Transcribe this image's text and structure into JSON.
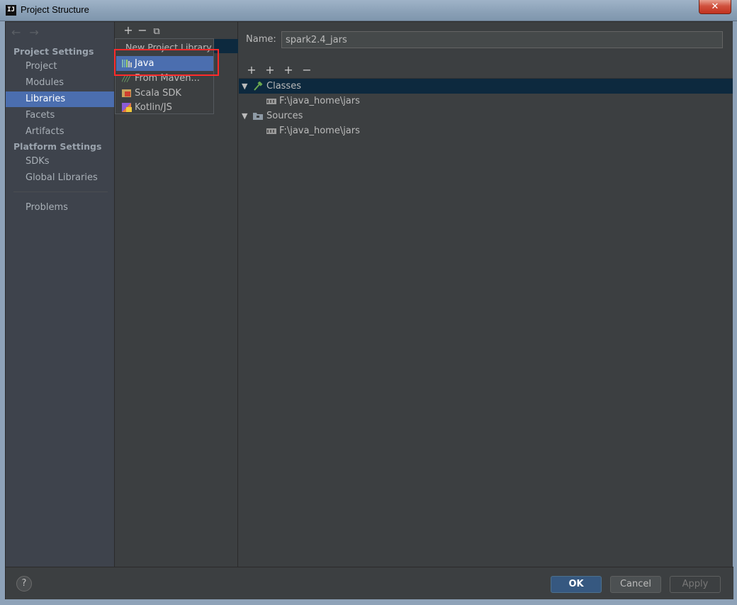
{
  "window": {
    "title": "Project Structure",
    "app_icon_text": "IJ",
    "close_glyph": "✕"
  },
  "nav": {
    "back_arrow": "←",
    "forward_arrow": "→",
    "project_settings_header": "Project Settings",
    "project_items": [
      "Project",
      "Modules",
      "Libraries",
      "Facets",
      "Artifacts"
    ],
    "platform_settings_header": "Platform Settings",
    "platform_items": [
      "SDKs",
      "Global Libraries"
    ],
    "problems": "Problems",
    "selected": "Libraries"
  },
  "mid_toolbar": {
    "add": "+",
    "remove": "−",
    "copy": "⧉"
  },
  "popup": {
    "header": "New Project Library",
    "items": [
      {
        "label": "Java",
        "icon": "java-library-icon",
        "highlighted": true
      },
      {
        "label": "From Maven...",
        "icon": "maven-icon",
        "highlighted": false
      },
      {
        "label": "Scala SDK",
        "icon": "scala-sdk-icon",
        "highlighted": false
      },
      {
        "label": "Kotlin/JS",
        "icon": "kotlin-js-icon",
        "highlighted": false
      }
    ]
  },
  "details": {
    "name_label": "Name:",
    "name_value": "spark2.4_jars",
    "toolbar": {
      "add": "+",
      "add_alt": "+",
      "add_jar": "+",
      "remove": "−"
    },
    "tree": [
      {
        "label": "Classes",
        "type": "group",
        "icon": "classes-hammer-icon"
      },
      {
        "label": "F:\\java_home\\jars",
        "type": "path",
        "icon": "jar-directory-icon"
      },
      {
        "label": "Sources",
        "type": "group",
        "icon": "sources-folder-icon"
      },
      {
        "label": "F:\\java_home\\jars",
        "type": "path",
        "icon": "jar-directory-icon"
      }
    ]
  },
  "buttons": {
    "help": "?",
    "ok": "OK",
    "cancel": "Cancel",
    "apply": "Apply"
  },
  "colors": {
    "selection": "#4b6eaf",
    "highlight_box": "#ff2a2a",
    "background": "#3c3f41"
  }
}
